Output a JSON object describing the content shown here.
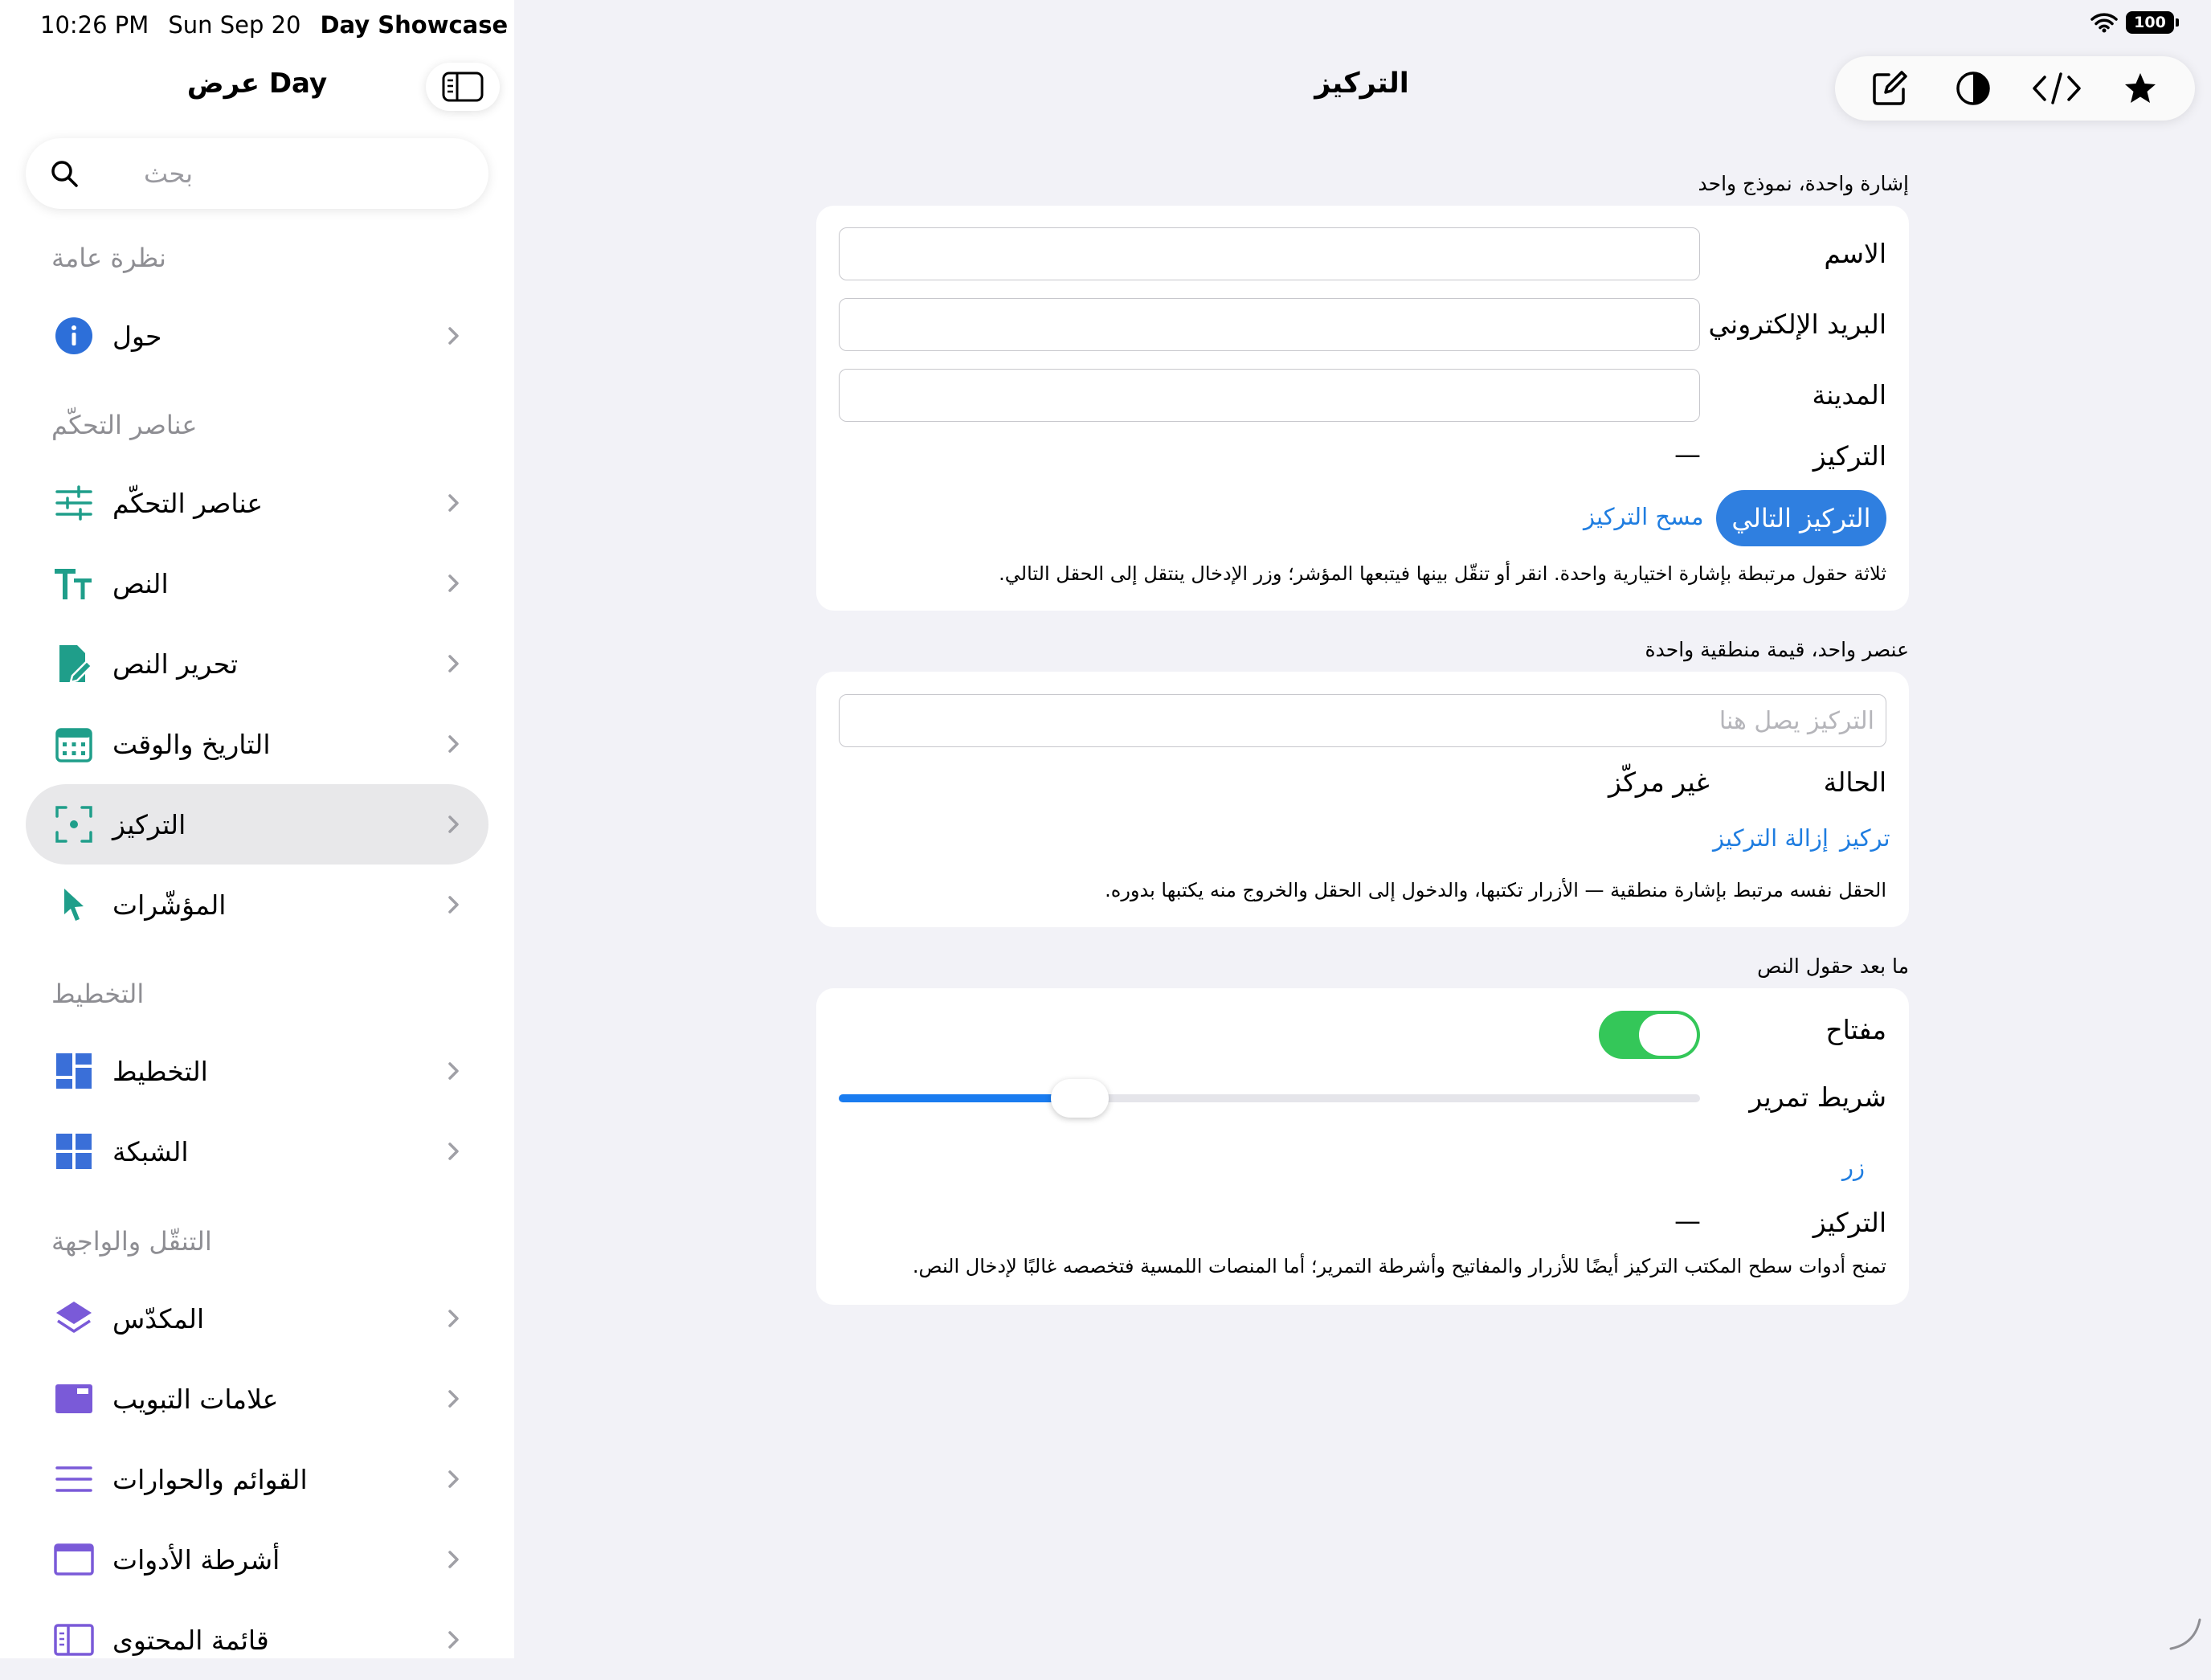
{
  "status_bar": {
    "time": "10:26 PM",
    "date": "Sun Sep 20",
    "app_name": "Day Showcase",
    "battery": "100"
  },
  "sidebar": {
    "title": "عرض Day",
    "search_placeholder": "بحث",
    "sections": {
      "overview": "نظرة عامة",
      "controls": "عناصر التحكّم",
      "layout": "التخطيط",
      "navigation": "التنقّل والواجهة"
    },
    "items": {
      "about": "حول",
      "controls": "عناصر التحكّم",
      "text": "النص",
      "text_editing": "تحرير النص",
      "date_time": "التاريخ والوقت",
      "focus": "التركيز",
      "pointers": "المؤشّرات",
      "layout": "التخطيط",
      "grid": "الشبكة",
      "stack": "المكدّس",
      "tabs": "علامات التبويب",
      "lists_dialogs": "القوائم والحوارات",
      "toolbars": "أشرطة الأدوات",
      "content_list": "قائمة المحتوى"
    }
  },
  "main": {
    "title": "التركيز",
    "group1": {
      "caption": "إشارة واحدة، نموذج واحد",
      "name_label": "الاسم",
      "email_label": "البريد الإلكتروني",
      "city_label": "المدينة",
      "focus_label": "التركيز",
      "focus_value": "—",
      "next_focus_button": "التركيز التالي",
      "clear_focus_link": "مسح التركيز",
      "note": "ثلاثة حقول مرتبطة بإشارة اختيارية واحدة. انقر أو تنقّل بينها فيتبعها المؤشر؛ وزر الإدخال ينتقل إلى الحقل التالي."
    },
    "group2": {
      "caption": "عنصر واحد، قيمة منطقية واحدة",
      "field_placeholder": "التركيز يصل هنا",
      "state_label": "الحالة",
      "state_value": "غير مركّز",
      "focus_link": "تركيز",
      "unfocus_link": "إزالة التركيز",
      "note": "الحقل نفسه مرتبط بإشارة منطقية — الأزرار تكتبها، والدخول إلى الحقل والخروج منه يكتبها بدوره."
    },
    "group3": {
      "caption": "ما بعد حقول النص",
      "toggle_label": "مفتاح",
      "toggle_on": true,
      "slider_label": "شريط تمرير",
      "slider_value": 0.28,
      "button_label": "زر",
      "focus_label": "التركيز",
      "focus_value": "—",
      "note": "تمنح أدوات سطح المكتب التركيز أيضًا للأزرار والمفاتيح وأشرطة التمرير؛ أما المنصات اللمسية فتخصصه غالبًا لإدخال النص."
    }
  },
  "colors": {
    "accent": "#2f7fe0",
    "toggle_on": "#34c759",
    "sidebar_icon_teal": "#1f9e8a",
    "sidebar_icon_blue": "#3a6fd8",
    "sidebar_icon_purple": "#7a5ad8"
  }
}
